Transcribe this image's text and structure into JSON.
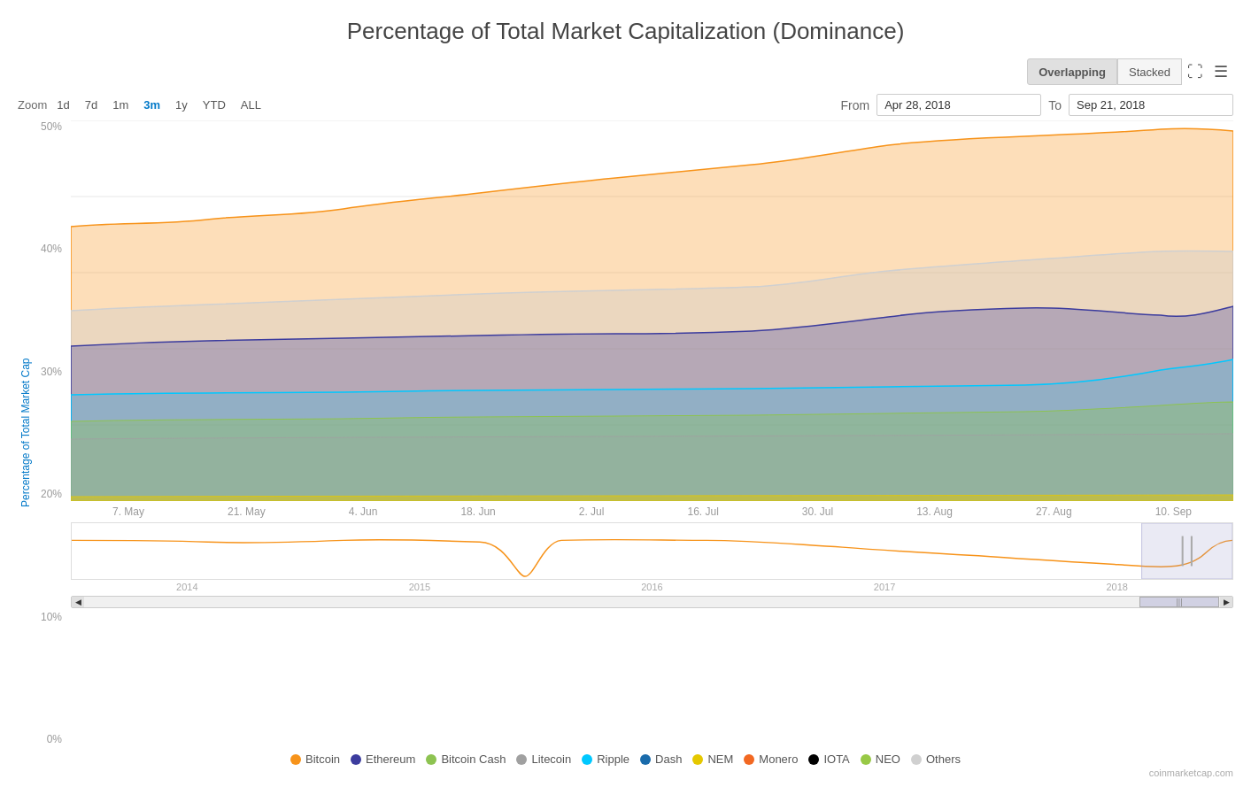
{
  "title": "Percentage of Total Market Capitalization (Dominance)",
  "viewButtons": [
    {
      "label": "Overlapping",
      "active": true
    },
    {
      "label": "Stacked",
      "active": false
    }
  ],
  "zoomLabel": "Zoom",
  "zoomOptions": [
    "1d",
    "7d",
    "1m",
    "3m",
    "1y",
    "YTD",
    "ALL"
  ],
  "dateRange": {
    "fromLabel": "From",
    "fromValue": "Apr 28, 2018",
    "toLabel": "To",
    "toValue": "Sep 21, 2018"
  },
  "yAxisLabel": "Percentage of Total Market Cap",
  "yTicks": [
    "50%",
    "40%",
    "30%",
    "20%",
    "10%",
    "0%"
  ],
  "xTicks": [
    "7. May",
    "21. May",
    "4. Jun",
    "18. Jun",
    "2. Jul",
    "16. Jul",
    "30. Jul",
    "13. Aug",
    "27. Aug",
    "10. Sep"
  ],
  "miniXTicks": [
    "2014",
    "2015",
    "2016",
    "2017",
    "2018"
  ],
  "legend": [
    {
      "color": "#f7931a",
      "label": "Bitcoin"
    },
    {
      "color": "#3c3c9e",
      "label": "Ethereum"
    },
    {
      "color": "#8dc351",
      "label": "Bitcoin Cash"
    },
    {
      "color": "#a0a0a0",
      "label": "Litecoin"
    },
    {
      "color": "#00c8ff",
      "label": "Ripple"
    },
    {
      "color": "#1a6bab",
      "label": "Dash"
    },
    {
      "color": "#e5c800",
      "label": "NEM"
    },
    {
      "color": "#f26822",
      "label": "Monero"
    },
    {
      "color": "#000000",
      "label": "IOTA"
    },
    {
      "color": "#98c946",
      "label": "NEO"
    },
    {
      "color": "#d0d0d0",
      "label": "Others"
    }
  ],
  "attribution": "coinmarketcap.com"
}
